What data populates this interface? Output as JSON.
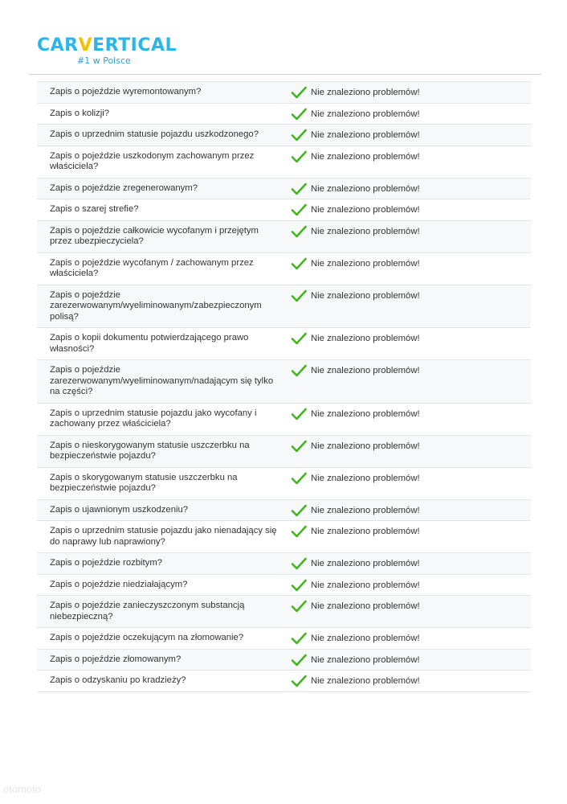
{
  "brand": {
    "name_prefix": "CAR",
    "name_v": "V",
    "name_suffix": "ERTICAL",
    "tagline": "#1 w Polsce",
    "accent_color": "#29b6e8",
    "v_color": "#f2c200"
  },
  "status_icon": "checkmark-icon",
  "status_color": "#43b51f",
  "rows": [
    {
      "question": "Zapis o pojeździe wyremontowanym?",
      "status": "Nie znaleziono problemów!"
    },
    {
      "question": "Zapis o kolizji?",
      "status": "Nie znaleziono problemów!"
    },
    {
      "question": "Zapis o uprzednim statusie pojazdu uszkodzonego?",
      "status": "Nie znaleziono problemów!"
    },
    {
      "question": "Zapis o pojeździe uszkodonym zachowanym przez właściciela?",
      "status": "Nie znaleziono problemów!"
    },
    {
      "question": "Zapis o pojeździe zregenerowanym?",
      "status": "Nie znaleziono problemów!"
    },
    {
      "question": "Zapis o szarej strefie?",
      "status": "Nie znaleziono problemów!"
    },
    {
      "question": "Zapis o pojeździe całkowicie wycofanym i przejętym przez ubezpieczyciela?",
      "status": "Nie znaleziono problemów!"
    },
    {
      "question": "Zapis o pojeździe wycofanym / zachowanym przez właściciela?",
      "status": "Nie znaleziono problemów!"
    },
    {
      "question": "Zapis o pojeździe zarezerwowanym/wyeliminowanym/zabezpieczonym polisą?",
      "status": "Nie znaleziono problemów!"
    },
    {
      "question": "Zapis o kopii dokumentu potwierdzającego prawo własności?",
      "status": "Nie znaleziono problemów!"
    },
    {
      "question": "Zapis o pojeździe zarezerwowanym/wyeliminowanym/nadającym się tylko na części?",
      "status": "Nie znaleziono problemów!"
    },
    {
      "question": "Zapis o uprzednim statusie pojazdu jako wycofany i zachowany przez właściciela?",
      "status": "Nie znaleziono problemów!"
    },
    {
      "question": "Zapis o nieskorygowanym statusie uszczerbku na bezpieczeństwie pojazdu?",
      "status": "Nie znaleziono problemów!"
    },
    {
      "question": "Zapis o skorygowanym statusie uszczerbku na bezpieczeństwie pojazdu?",
      "status": "Nie znaleziono problemów!"
    },
    {
      "question": "Zapis o ujawnionym uszkodzeniu?",
      "status": "Nie znaleziono problemów!"
    },
    {
      "question": "Zapis o uprzednim statusie pojazdu jako nienadający się do naprawy lub naprawiony?",
      "status": "Nie znaleziono problemów!"
    },
    {
      "question": "Zapis o pojeździe rozbitym?",
      "status": "Nie znaleziono problemów!"
    },
    {
      "question": "Zapis o pojeździe niedziałającym?",
      "status": "Nie znaleziono problemów!"
    },
    {
      "question": "Zapis o pojeździe zanieczyszczonym substancją niebezpieczną?",
      "status": "Nie znaleziono problemów!"
    },
    {
      "question": "Zapis o pojeździe oczekującym na złomowanie?",
      "status": "Nie znaleziono problemów!"
    },
    {
      "question": "Zapis o pojeździe złomowanym?",
      "status": "Nie znaleziono problemów!"
    },
    {
      "question": "Zapis o odzyskaniu po kradzieży?",
      "status": "Nie znaleziono problemów!"
    }
  ],
  "watermark": "otomoto"
}
